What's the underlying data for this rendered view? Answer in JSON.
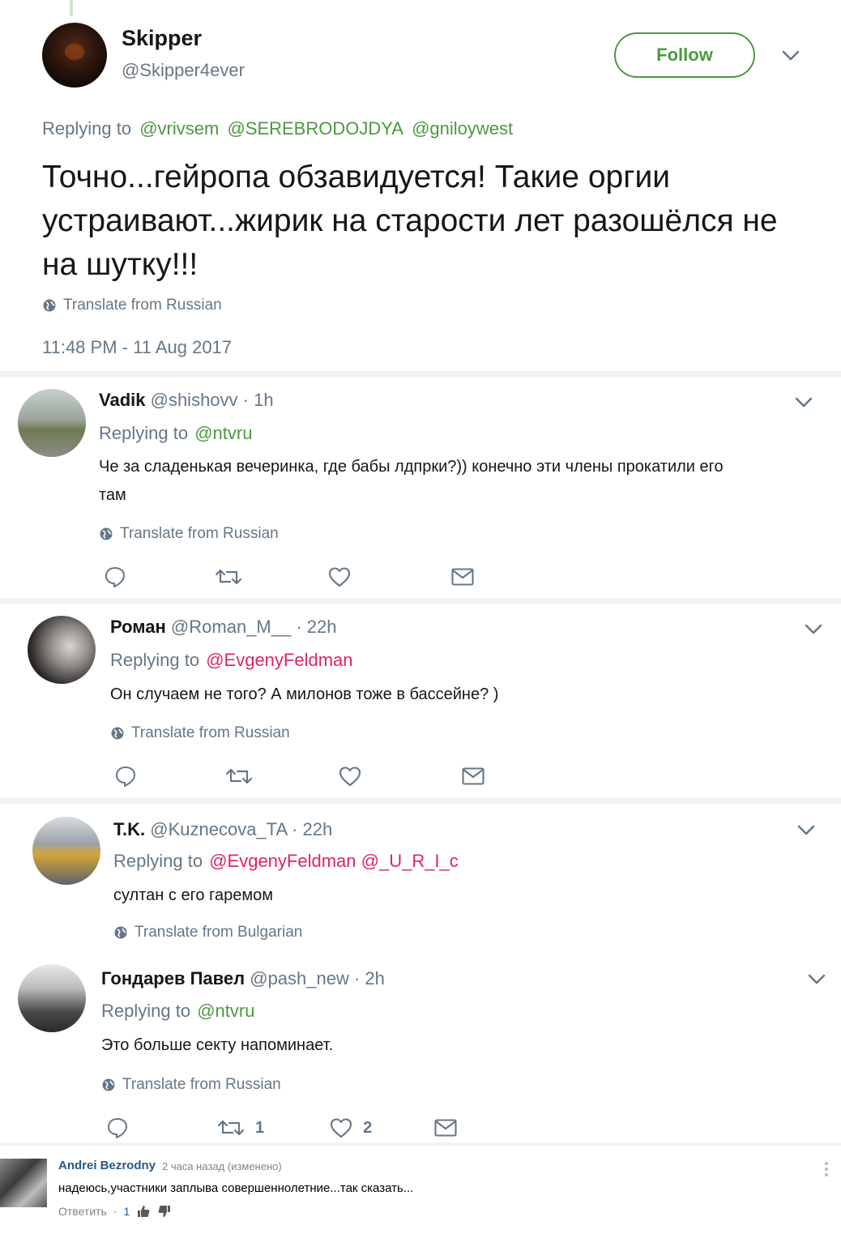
{
  "main_tweet": {
    "name": "Skipper",
    "handle": "@Skipper4ever",
    "follow_label": "Follow",
    "replying_prefix": "Replying to",
    "replying_handles": [
      "@vrivsem",
      "@SEREBRODOJDYA",
      "@gniloywest"
    ],
    "text": "Точно...гейропа обзавидуется! Такие оргии устраивают...жирик на старости лет разошёлся не на шутку!!!",
    "translate": "Translate from Russian",
    "timestamp": "11:48 PM - 11 Aug 2017"
  },
  "replies": [
    {
      "name": "Vadik",
      "meta": "@shishovv · 1h",
      "replying_prefix": "Replying to",
      "replying_handles": "@ntvru",
      "text": "Че за сладенькая вечеринка, где бабы лдпрки?)) конечно эти члены прокатили его там",
      "translate": "Translate from Russian",
      "retweets": "",
      "likes": ""
    },
    {
      "name": "Роман",
      "meta": "@Roman_M__ · 22h",
      "replying_prefix": "Replying to",
      "replying_handles": "@EvgenyFeldman",
      "text": "Он случаем не того?  А милонов тоже в бассейне? )",
      "translate": "Translate from Russian",
      "retweets": "",
      "likes": ""
    },
    {
      "name": "T.K.",
      "meta": "@Kuznecova_TA · 22h",
      "replying_prefix": "Replying to",
      "replying_handles": "@EvgenyFeldman @_U_R_I_c",
      "text": "султан с его гаремом",
      "translate": "Translate from Bulgarian"
    },
    {
      "name": "Гондарев Павел",
      "meta": "@pash_new · 2h",
      "replying_prefix": "Replying to",
      "replying_handles": "@ntvru",
      "text": "Это больше секту напоминает.",
      "translate": "Translate from Russian",
      "retweets": "1",
      "likes": "2"
    }
  ],
  "vk_comment": {
    "name": "Andrei Bezrodny",
    "meta": "2 часа назад (изменено)",
    "text": "надеюсь,участники заплыва совершеннолетние...так сказать...",
    "reply_label": "Ответить",
    "separator": "·",
    "likes": "1"
  },
  "colors": {
    "accent": "#4a9a3f",
    "mention_red": "#e0245e",
    "secondary_text": "#657786",
    "vk_link": "#2a5885"
  }
}
